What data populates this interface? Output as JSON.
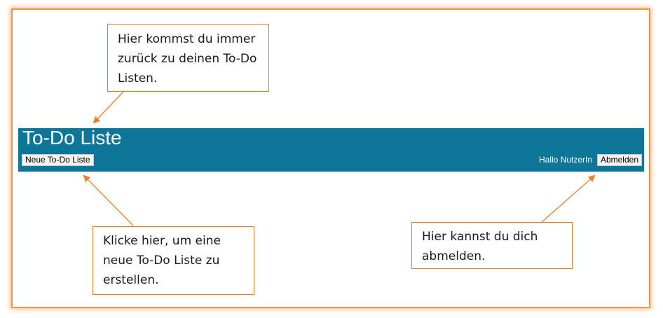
{
  "app": {
    "title": "To-Do Liste",
    "new_list_button": "Neue To-Do Liste",
    "greeting": "Hallo NutzerIn",
    "logout_button": "Abmelden"
  },
  "callouts": {
    "home": "Hier kommst du immer zurück zu deinen To-Do Listen.",
    "new_list": "Klicke hier, um eine neue To-Do Liste zu erstellen.",
    "logout": "Hier kannst du dich abmelden."
  },
  "colors": {
    "header_bg": "#0e7698",
    "accent_orange": "#f0954a",
    "arrow": "#e8812f"
  }
}
